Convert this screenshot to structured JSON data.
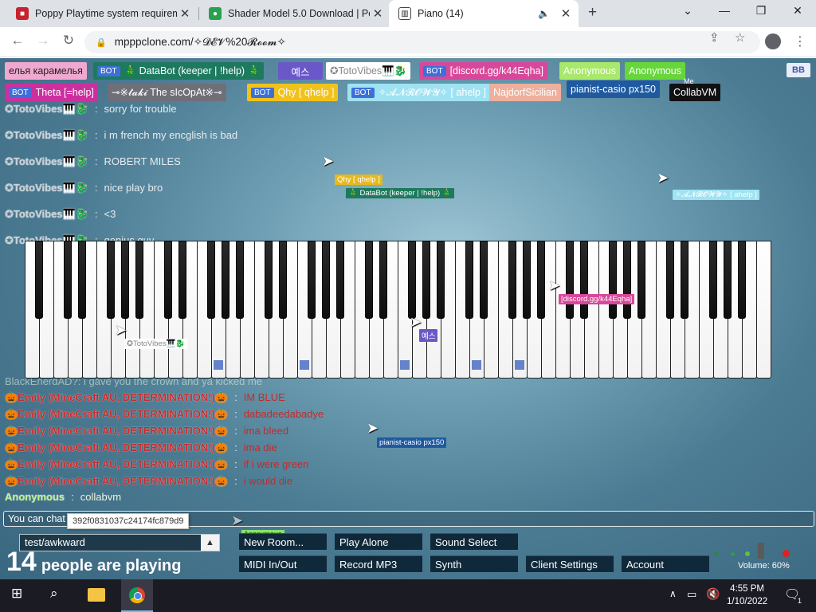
{
  "browser": {
    "tabs": [
      {
        "title": "Poppy Playtime system requirem",
        "close": "✕"
      },
      {
        "title": "Shader Model 5.0 Download | Pe",
        "close": "✕"
      },
      {
        "title": "Piano (14)",
        "close": "✕"
      }
    ],
    "new_tab": "+",
    "url": "mpppclone.com/✧𝓓𝓔𝓥%20𝓡𝓸𝓸𝓶✧"
  },
  "players": [
    {
      "name": "елья карамелья",
      "bot": false,
      "color": "#f0a8d0",
      "text_color": "#222"
    },
    {
      "name": "🎄 DataBot (keeper | !help) 🎄",
      "bot": true,
      "color": "#1e7a5e"
    },
    {
      "name": "예스",
      "bot": false,
      "color": "#6b58c8"
    },
    {
      "name": "✪TotoVibes🎹🐉",
      "bot": false,
      "color": "#ffffff",
      "text_color": "#888"
    },
    {
      "name": "[discord.gg/k44Eqha]",
      "bot": true,
      "color": "#d8489a"
    },
    {
      "name": "Anonymous",
      "bot": false,
      "color": "#a8e86a",
      "text_color": "#fff"
    },
    {
      "name": "Anonymous",
      "bot": false,
      "color": "#66d63a"
    },
    {
      "name": "Theta [=help]",
      "bot": true,
      "color": "#cc2f9e"
    },
    {
      "name": "⊸※𝓽𝓪𝓴𝓲 The sIcOpAt※⊸",
      "bot": false,
      "color": "#6f6f78"
    },
    {
      "name": "Qhy [ qhelp ]",
      "bot": true,
      "color": "#f2c21c"
    },
    {
      "name": "✧𝓐𝓝𝓡𝓞𝓦𝓨✧ [ ahelp ]",
      "bot": true,
      "color": "#9fe3f2"
    },
    {
      "name": "NajdorfSicilian",
      "bot": false,
      "color": "#eeb09c"
    },
    {
      "name": "pianist-casio px150",
      "bot": false,
      "color": "#1f5aa0"
    },
    {
      "name": "CollabVM",
      "bot": false,
      "color": "#111111",
      "badge": "Me"
    }
  ],
  "player_bb": "BB",
  "chat": [
    {
      "name": "✪TotoVibes🎹🐉",
      "sep": ":",
      "msg": "sorry for trouble"
    },
    {
      "name": "✪TotoVibes🎹🐉",
      "sep": ":",
      "msg": "i m french my encglish is bad"
    },
    {
      "name": "✪TotoVibes🎹🐉",
      "sep": ":",
      "msg": "ROBERT MILES"
    },
    {
      "name": "✪TotoVibes🎹🐉",
      "sep": ":",
      "msg": "nice play bro"
    },
    {
      "name": "✪TotoVibes🎹🐉",
      "sep": ":",
      "msg": "<3"
    },
    {
      "name": "✪TotoVibes🎹🐉",
      "sep": ":",
      "msg": "genius guy"
    }
  ],
  "chat_partial": {
    "text": "BlackEnerdAD?: i gave you the crown and ya kicked me"
  },
  "chat_red": [
    {
      "name": "🎃Emily (MineCraft AU, DETERMINATION!)🎃",
      "sep": ":",
      "msg": "IM BLUE"
    },
    {
      "name": "🎃Emily (MineCraft AU, DETERMINATION!)🎃",
      "sep": ":",
      "msg": "dabadeedabadye"
    },
    {
      "name": "🎃Emily (MineCraft AU, DETERMINATION!)🎃",
      "sep": ":",
      "msg": "ima bleed"
    },
    {
      "name": "🎃Emily (MineCraft AU, DETERMINATION!)🎃",
      "sep": ":",
      "msg": "ima die"
    },
    {
      "name": "🎃Emily (MineCraft AU, DETERMINATION!)🎃",
      "sep": ":",
      "msg": "if i were green"
    },
    {
      "name": "🎃Emily (MineCraft AU, DETERMINATION!)🎃",
      "sep": ":",
      "msg": "i would die"
    }
  ],
  "chat_last": {
    "name": "Anonymous",
    "sep": ":",
    "msg": "collabvm"
  },
  "chat_input_hint": "You can chat",
  "tooltip": "392f0831037c24174fc879d9",
  "cursors": [
    {
      "label": "Qhy [ qhelp ]",
      "color": "#e6b91c"
    },
    {
      "label": "🎄 DataBot (keeper | !help) 🎄",
      "color": "#1e7a5e"
    },
    {
      "label": "✧𝓐𝓝𝓡𝓞𝓦𝓨✧ [ ahelp ]",
      "color": "#9fe3f2"
    },
    {
      "label": "[discord.gg/k44Eqha]",
      "color": "#d8489a"
    },
    {
      "label": "예스",
      "color": "#6b58c8"
    },
    {
      "label": "✪TotoVibes🎹🐉",
      "color": "#ffffff"
    },
    {
      "label": "pianist-casio px150",
      "color": "#1f5aa0"
    }
  ],
  "room": {
    "name": "test/awkward",
    "arrow": "▲"
  },
  "count": {
    "num": "14",
    "label": "people are playing"
  },
  "anon_chip": "Anonymous",
  "buttons": {
    "new_room": "New Room...",
    "play_alone": "Play Alone",
    "sound_select": "Sound Select",
    "midi": "MIDI In/Out",
    "record": "Record MP3",
    "synth": "Synth",
    "client_settings": "Client Settings",
    "account": "Account"
  },
  "volume": {
    "label": "Volume: 60%",
    "level": 0.6
  },
  "piano": {
    "white_keys": 52,
    "pressed": [
      {
        "key": 13,
        "color": "#4a6fc4"
      },
      {
        "key": 19,
        "color": "#4a6fc4"
      },
      {
        "key": 26,
        "color": "#4a6fc4"
      },
      {
        "key": 31,
        "color": "#4a6fc4"
      },
      {
        "key": 34,
        "color": "#4a6fc4"
      }
    ]
  },
  "taskbar": {
    "time": "4:55 PM",
    "date": "1/10/2022",
    "notif": "1"
  },
  "colors": {
    "bg": "#4b7b92",
    "white_key": "#ffffff",
    "black_key": "#111111",
    "pressed": "#4a6fc4"
  }
}
